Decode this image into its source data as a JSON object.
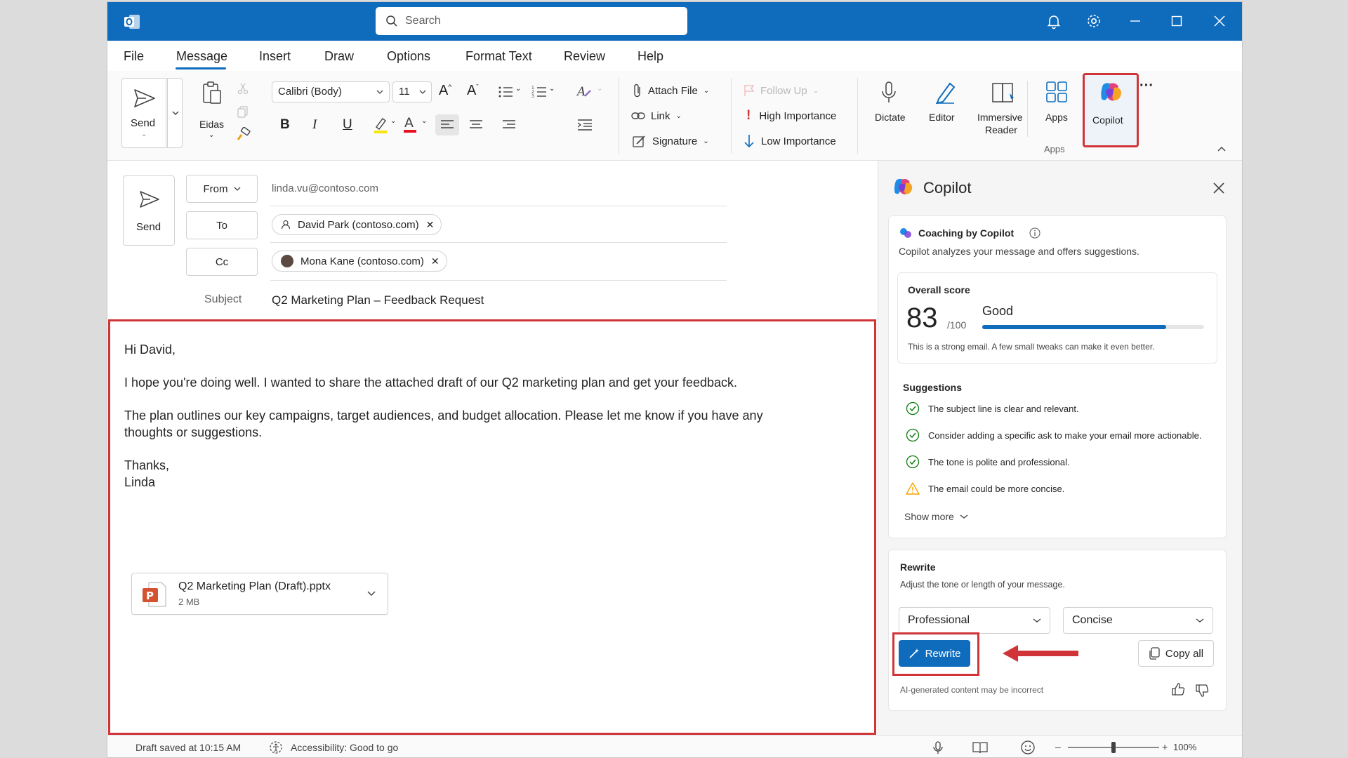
{
  "titlebar": {
    "search_placeholder": "Search"
  },
  "tabs": [
    "File",
    "Message",
    "Insert",
    "Draw",
    "Options",
    "Format Text",
    "Review",
    "Help"
  ],
  "ribbon": {
    "send": "Send",
    "paste": "Eidas",
    "font": "Calibri (Body)",
    "font_size": "11",
    "attach_file": "Attach File",
    "link": "Link",
    "signature": "Signature",
    "follow_up": "Follow Up",
    "high_importance": "High Importance",
    "low_importance": "Low Importance",
    "dictate": "Dictate",
    "editor": "Editor",
    "immersive_reader_1": "Immersive",
    "immersive_reader_2": "Reader",
    "apps": "Apps",
    "apps_group": "Apps",
    "copilot": "Copilot",
    "more": "···"
  },
  "compose": {
    "send": "Send",
    "from_label": "From",
    "from_value": "linda.vu@contoso.com",
    "to_label": "To",
    "to_recipient": "David Park (contoso.com)",
    "cc_label": "Cc",
    "cc_recipient": "Mona Kane (contoso.com)",
    "subject_label": "Subject",
    "subject_value": "Q2 Marketing Plan – Feedback Request"
  },
  "body": {
    "greeting": "Hi David,",
    "para1": "I hope you're doing well. I wanted to share the attached draft of our Q2 marketing plan and get your feedback.",
    "para2_line1": "The plan outlines our key campaigns, target audiences, and budget allocation. Please let me know if you have any",
    "para2_line2": "thoughts or suggestions.",
    "closing": "Thanks,",
    "signature": "Linda",
    "attachment_name": "Q2 Marketing Plan (Draft).pptx",
    "attachment_size": "2 MB"
  },
  "status": {
    "draft_saved": "Draft saved at 10:15 AM",
    "accessibility": "Accessibility: Good to go",
    "zoom": "100%",
    "zoom_level": 0.5
  },
  "copilot": {
    "title": "Copilot",
    "coaching_title": "Coaching by Copilot",
    "coaching_desc": "Copilot analyzes your message and offers suggestions.",
    "overall_label": "Overall score",
    "score": "83",
    "score_max": "/100",
    "score_value": 83,
    "rating": "Good",
    "score_note": "This is a strong email. A few small tweaks can make it even better.",
    "suggestions_title": "Suggestions",
    "suggestions": [
      {
        "text": "The subject line is clear and relevant.",
        "status": "check"
      },
      {
        "text": "Consider adding a specific ask to make your email more actionable.",
        "status": "check"
      },
      {
        "text": "The tone is polite and professional.",
        "status": "check"
      },
      {
        "text": "The email could be more concise.",
        "status": "warning"
      }
    ],
    "show_more": "Show more",
    "rewrite_title": "Rewrite",
    "rewrite_desc": "Adjust the tone or length of your message.",
    "tone": "Professional",
    "length": "Concise",
    "rewrite_button": "Rewrite",
    "copy_all": "Copy all",
    "disclaimer": "AI-generated content may be incorrect"
  },
  "colors": {
    "brand": "#0f6cbd",
    "highlight": "#d13438",
    "success": "#107c10",
    "warning": "#f7a400"
  }
}
